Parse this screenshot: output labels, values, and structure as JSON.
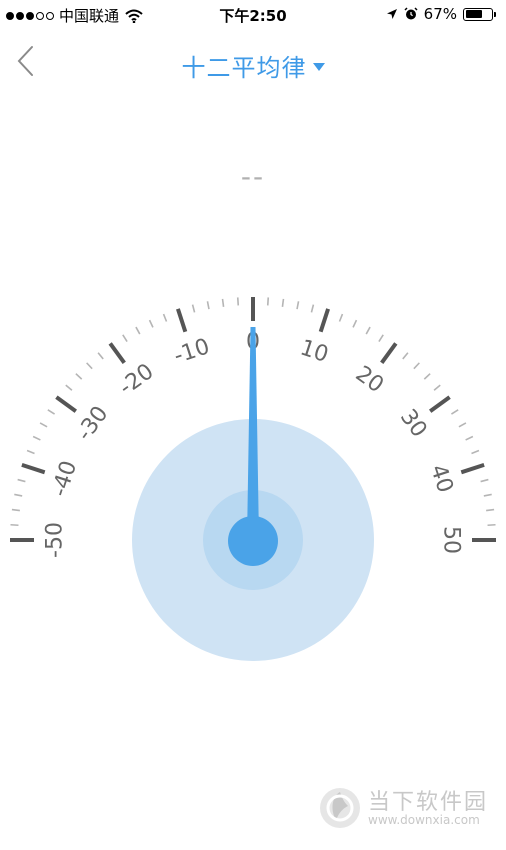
{
  "status_bar": {
    "signal_dots": [
      true,
      true,
      true,
      false,
      false
    ],
    "carrier": "中国联通",
    "time": "下午2:50",
    "battery_percent": "67%",
    "battery_level": 0.67
  },
  "nav": {
    "back_icon": "chevron-left-icon",
    "title": "十二平均律",
    "title_dropdown_icon": "caret-down-icon"
  },
  "note": "--",
  "tuner": {
    "min": -50,
    "max": 50,
    "value": 0,
    "major_step": 10,
    "minor_per_major": 5,
    "labels": [
      "-50",
      "-40",
      "-30",
      "-20",
      "-10",
      "0",
      "10",
      "20",
      "30",
      "40",
      "50"
    ],
    "needle_color": "#4aa3e8",
    "outer_circle_color": "#cfe3f4",
    "inner_circle_color": "#b8d8f1",
    "tick_color": "#555555"
  },
  "watermark": {
    "text": "当下软件园",
    "url": "www.downxia.com"
  }
}
